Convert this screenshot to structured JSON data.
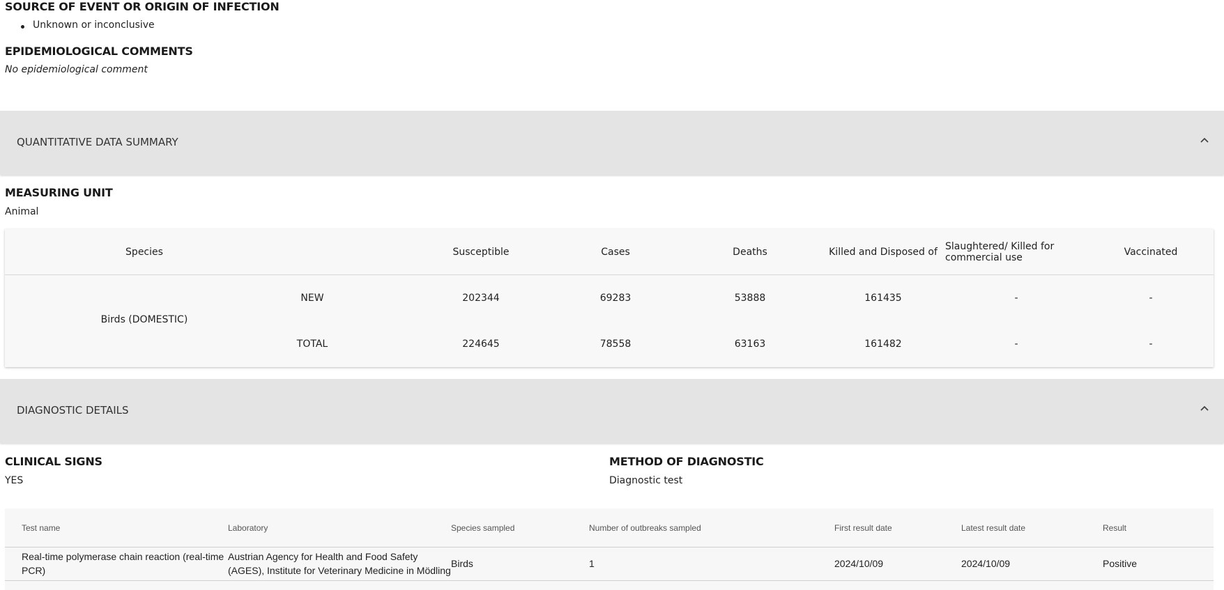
{
  "source": {
    "heading": "SOURCE OF EVENT OR ORIGIN OF INFECTION",
    "items": [
      "Unknown or inconclusive"
    ]
  },
  "epi": {
    "heading": "EPIDEMIOLOGICAL COMMENTS",
    "text": "No epidemiological comment"
  },
  "quantitative": {
    "panel_title": "QUANTITATIVE DATA SUMMARY",
    "measuring_unit_heading": "MEASURING UNIT",
    "measuring_unit": "Animal",
    "columns": [
      "Species",
      "Susceptible",
      "Cases",
      "Deaths",
      "Killed and Disposed of",
      "Slaughtered/ Killed for commercial use",
      "Vaccinated"
    ],
    "species": "Birds (DOMESTIC)",
    "rows": [
      {
        "type": "NEW",
        "susceptible": "202344",
        "cases": "69283",
        "deaths": "53888",
        "killed": "161435",
        "slaughtered": "-",
        "vaccinated": "-"
      },
      {
        "type": "TOTAL",
        "susceptible": "224645",
        "cases": "78558",
        "deaths": "63163",
        "killed": "161482",
        "slaughtered": "-",
        "vaccinated": "-"
      }
    ]
  },
  "diagnostic": {
    "panel_title": "DIAGNOSTIC DETAILS",
    "clinical_signs_heading": "CLINICAL SIGNS",
    "clinical_signs": "YES",
    "method_heading": "METHOD OF DIAGNOSTIC",
    "method": "Diagnostic test",
    "columns": [
      "Test name",
      "Laboratory",
      "Species sampled",
      "Number of outbreaks sampled",
      "First result date",
      "Latest result date",
      "Result"
    ],
    "rows": [
      {
        "test_name": "Real-time polymerase chain reaction (real-time PCR)",
        "laboratory": "Austrian Agency for Health and Food Safety (AGES), Institute for Veterinary Medicine in Mödling",
        "species": "Birds",
        "outbreaks": "1",
        "first_date": "2024/10/09",
        "latest_date": "2024/10/09",
        "result": "Positive"
      }
    ]
  },
  "icons": {
    "chevron": "chevron-up-icon"
  },
  "colors": {
    "panel_bg": "#e4e4e4",
    "card_bg": "#f8f8f8"
  }
}
